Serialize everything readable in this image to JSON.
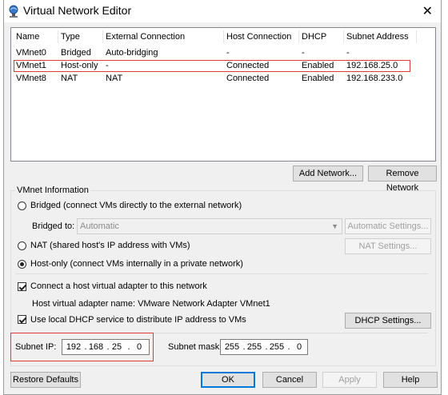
{
  "window": {
    "title": "Virtual Network Editor",
    "close_glyph": "✕"
  },
  "table": {
    "headers": [
      "Name",
      "Type",
      "External Connection",
      "Host Connection",
      "DHCP",
      "Subnet Address"
    ],
    "rows": [
      [
        "VMnet0",
        "Bridged",
        "Auto-bridging",
        "-",
        "-",
        "-"
      ],
      [
        "VMnet1",
        "Host-only",
        "-",
        "Connected",
        "Enabled",
        "192.168.25.0"
      ],
      [
        "VMnet8",
        "NAT",
        "NAT",
        "Connected",
        "Enabled",
        "192.168.233.0"
      ]
    ],
    "selected_row": 1
  },
  "buttons": {
    "add_network": "Add Network...",
    "remove_network": "Remove Network",
    "auto_settings": "Automatic Settings...",
    "nat_settings": "NAT Settings...",
    "dhcp_settings": "DHCP Settings...",
    "restore_defaults": "Restore Defaults",
    "ok": "OK",
    "cancel": "Cancel",
    "apply": "Apply",
    "help": "Help"
  },
  "vmnet_info": {
    "group_label": "VMnet Information",
    "bridged_label": "Bridged (connect VMs directly to the external network)",
    "bridged_to_label": "Bridged to:",
    "bridged_to_value": "Automatic",
    "nat_label": "NAT (shared host's IP address with VMs)",
    "hostonly_label": "Host-only (connect VMs internally in a private network)",
    "selected_mode": "hostonly",
    "connect_adapter_label": "Connect a host virtual adapter to this network",
    "connect_adapter_checked": true,
    "adapter_name_label": "Host virtual adapter name: VMware Network Adapter VMnet1",
    "dhcp_label": "Use local DHCP service to distribute IP address to VMs",
    "dhcp_checked": true,
    "subnet_ip_label": "Subnet IP:",
    "subnet_ip": [
      "192",
      "168",
      "25",
      "0"
    ],
    "subnet_mask_label": "Subnet mask:",
    "subnet_mask": [
      "255",
      "255",
      "255",
      "0"
    ],
    "ip_dot": "."
  },
  "colors": {
    "highlight_red": "#e23a3a",
    "default_button_blue": "#0078d7"
  }
}
